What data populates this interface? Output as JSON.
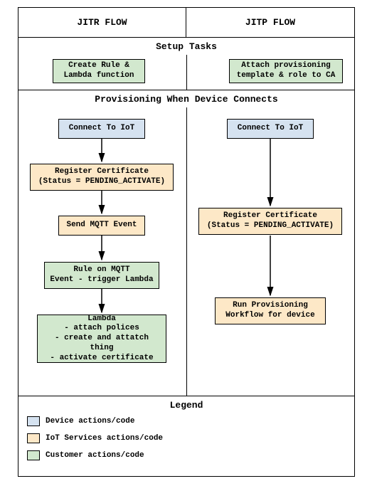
{
  "header": {
    "left": "JITR FLOW",
    "right": "JITP FLOW"
  },
  "setup": {
    "title": "Setup Tasks",
    "left_box": "Create Rule &\nLambda function",
    "right_box": "Attach provisioning\ntemplate & role to CA"
  },
  "prov": {
    "title": "Provisioning When Device Connects",
    "jitr": {
      "connect": "Connect To IoT",
      "register": "Register Certificate\n(Status = PENDING_ACTIVATE)",
      "mqtt": "Send MQTT Event",
      "rule": "Rule on MQTT\nEvent - trigger Lambda",
      "lambda": "Lambda\n- attach polices\n- create and attatch thing\n- activate certificate"
    },
    "jitp": {
      "connect": "Connect To IoT",
      "register": "Register Certificate\n(Status = PENDING_ACTIVATE)",
      "run": "Run Provisioning\nWorkflow for device"
    }
  },
  "legend": {
    "title": "Legend",
    "device": "Device actions/code",
    "iot": "IoT Services actions/code",
    "customer": "Customer actions/code"
  }
}
